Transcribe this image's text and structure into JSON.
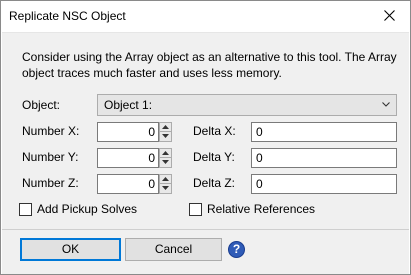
{
  "window": {
    "title": "Replicate NSC Object"
  },
  "info_text": "Consider using the Array object as an alternative to this tool. The Array object traces much faster and uses less memory.",
  "object": {
    "label": "Object:",
    "selected": "Object 1:"
  },
  "numbers": [
    {
      "label": "Number X:",
      "value": "0"
    },
    {
      "label": "Number Y:",
      "value": "0"
    },
    {
      "label": "Number Z:",
      "value": "0"
    }
  ],
  "deltas": [
    {
      "label": "Delta X:",
      "value": "0"
    },
    {
      "label": "Delta Y:",
      "value": "0"
    },
    {
      "label": "Delta Z:",
      "value": "0"
    }
  ],
  "checkboxes": {
    "add_pickup": {
      "label": "Add Pickup Solves",
      "checked": false
    },
    "relative_refs": {
      "label": "Relative References",
      "checked": false
    }
  },
  "buttons": {
    "ok": "OK",
    "cancel": "Cancel",
    "help": "?"
  },
  "icons": {
    "close": "close-icon",
    "help": "help-icon",
    "dropdown": "chevron-down-icon"
  },
  "colors": {
    "accent": "#0078d7",
    "help": "#2f5bb7"
  }
}
